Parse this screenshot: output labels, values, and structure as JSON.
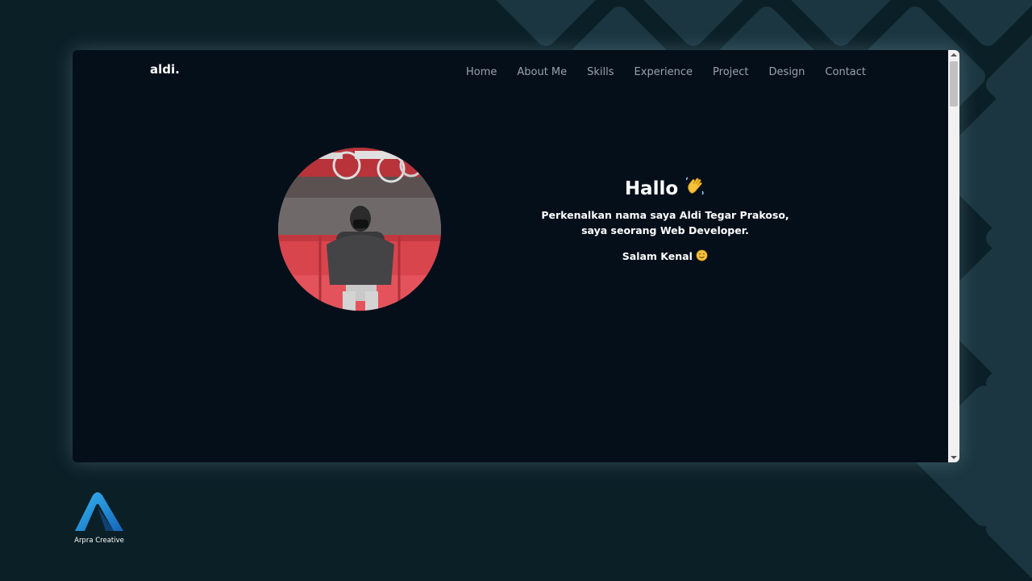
{
  "logo": "aldi.",
  "nav": {
    "items": [
      "Home",
      "About Me",
      "Skills",
      "Experience",
      "Project",
      "Design",
      "Contact"
    ]
  },
  "hero": {
    "title": "Hallo",
    "title_emoji": "waving-hand-icon",
    "intro_line1": "Perkenalkan nama saya Aldi Tegar Prakoso,",
    "intro_line2": "saya seorang Web Developer.",
    "greeting": "Salam Kenal",
    "greeting_emoji": "smiling-face-icon"
  },
  "footer_brand": {
    "name": "Arpra Creative"
  },
  "colors": {
    "page_bg": "#0b1f27",
    "pattern": "#1b3640",
    "window_bg": "#050f1a",
    "nav_text": "#9aa3ab",
    "text": "#ffffff",
    "brand_blue": "#1f8fd6"
  }
}
